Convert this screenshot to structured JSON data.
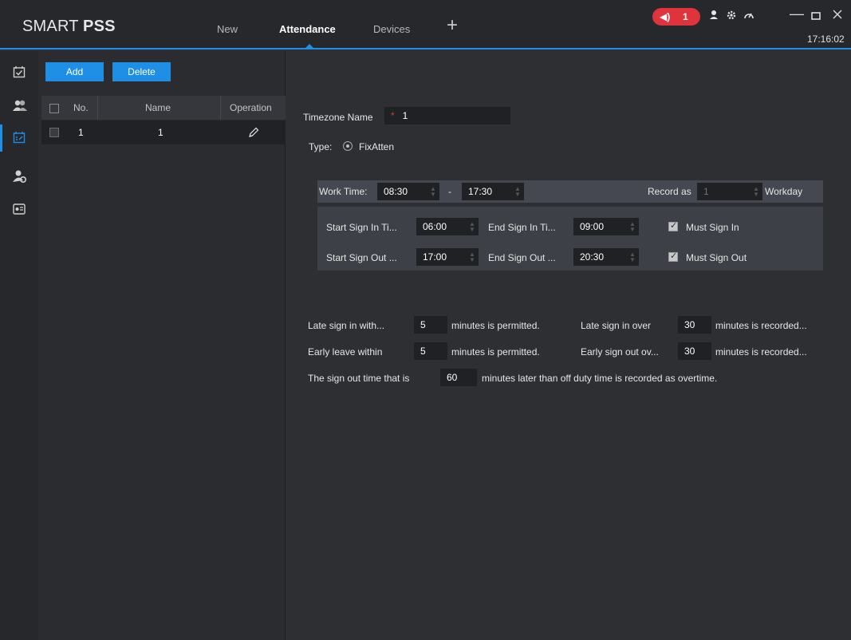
{
  "app": {
    "logo_light": "SMART ",
    "logo_bold": "PSS"
  },
  "tabs": [
    {
      "label": "New"
    },
    {
      "label": "Attendance"
    },
    {
      "label": "Devices"
    }
  ],
  "titlebar": {
    "alarm_count": "1",
    "clock": "17:16:02"
  },
  "icons": [
    "attendance-check-icon",
    "users-icon",
    "schedule-icon",
    "user-settings-icon",
    "report-icon",
    "edit-icon",
    "speaker-icon",
    "user-icon",
    "gear-icon",
    "dashboard-icon",
    "minimize-icon",
    "maximize-icon",
    "close-icon",
    "plus-icon"
  ],
  "colors": {
    "accent": "#1f8fe6",
    "alarm": "#e0343d",
    "background": "#2d2f33"
  },
  "list": {
    "add_label": "Add",
    "delete_label": "Delete",
    "columns": [
      "No.",
      "Name",
      "Operation"
    ],
    "rows": [
      {
        "no": "1",
        "name": "1"
      }
    ]
  },
  "form": {
    "timezone_label": "Timezone Name",
    "timezone_required": "*",
    "timezone_value": "1",
    "type_label": "Type:",
    "type_value": "FixAtten",
    "work_time_label": "Work Time:",
    "work_start": "08:30",
    "work_sep": "-",
    "work_end": "17:30",
    "record_as_label": "Record as",
    "record_as_value": "1",
    "workday_label": "Workday",
    "start_sign_in_label": "Start Sign In Ti...",
    "start_sign_in": "06:00",
    "end_sign_in_label": "End Sign In Ti...",
    "end_sign_in": "09:00",
    "must_sign_in_label": "Must Sign In",
    "start_sign_out_label": "Start Sign Out ...",
    "start_sign_out": "17:00",
    "end_sign_out_label": "End Sign Out ...",
    "end_sign_out": "20:30",
    "must_sign_out_label": "Must Sign Out",
    "late_within_label": "Late sign in with...",
    "late_within": "5",
    "late_within_suffix": "minutes is permitted.",
    "late_over_label": "Late sign in over",
    "late_over": "30",
    "late_over_suffix": "minutes is recorded...",
    "early_within_label": "Early leave within",
    "early_within": "5",
    "early_within_suffix": "minutes is permitted.",
    "early_over_label": "Early sign out ov...",
    "early_over": "30",
    "early_over_suffix": "minutes is recorded...",
    "overtime_prefix": "The sign out time that is",
    "overtime_value": "60",
    "overtime_suffix": "minutes later than off duty time is recorded as overtime."
  }
}
